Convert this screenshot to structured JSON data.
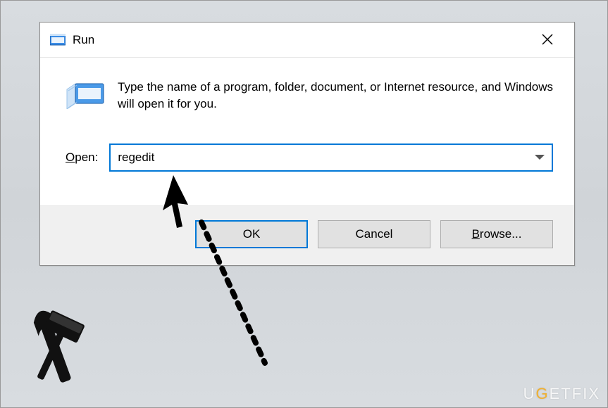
{
  "window": {
    "title": "Run",
    "prompt": "Type the name of a program, folder, document, or Internet resource, and Windows will open it for you.",
    "open_label_prefix": "O",
    "open_label_suffix": "pen:",
    "input_value": "regedit",
    "buttons": {
      "ok": "OK",
      "cancel": "Cancel",
      "browse_prefix": "B",
      "browse_suffix": "rowse..."
    }
  },
  "watermark": {
    "prefix": "U",
    "highlight": "G",
    "suffix": "ETFIX"
  }
}
